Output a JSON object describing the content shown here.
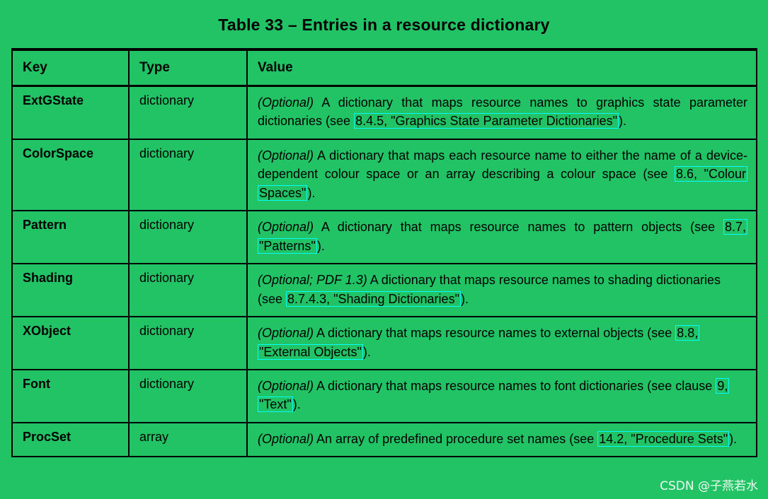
{
  "title": "Table 33 –  Entries in a resource dictionary",
  "columns": [
    "Key",
    "Type",
    "Value"
  ],
  "rows": [
    {
      "key": "ExtGState",
      "type": "dictionary",
      "optional": "(Optional)",
      "value_pre": " A dictionary that maps resource names to graphics state parameter dictionaries (see ",
      "link": "8.4.5, \"Graphics State Parameter Dictionaries\"",
      "value_post": ")."
    },
    {
      "key": "ColorSpace",
      "type": "dictionary",
      "optional": "(Optional)",
      "value_pre": " A dictionary that maps each resource name to either the name of a device-dependent colour space or an array describing a colour space (see ",
      "link": "8.6, \"Colour Spaces\"",
      "value_post": ")."
    },
    {
      "key": "Pattern",
      "type": "dictionary",
      "optional": "(Optional)",
      "value_pre": " A dictionary that maps resource names to pattern objects (see ",
      "link": "8.7, \"Patterns\"",
      "value_post": ")."
    },
    {
      "key": "Shading",
      "type": "dictionary",
      "optional": "(Optional; PDF 1.3)",
      "value_pre": " A dictionary that maps resource names to shading dictionaries (see ",
      "link": "8.7.4.3, \"Shading Dictionaries\"",
      "value_post": ")."
    },
    {
      "key": "XObject",
      "type": "dictionary",
      "optional": "(Optional)",
      "value_pre": " A dictionary that maps resource names to external objects (see ",
      "link": "8.8, \"External Objects\"",
      "value_post": ")."
    },
    {
      "key": "Font",
      "type": "dictionary",
      "optional": "(Optional)",
      "value_pre": " A dictionary that maps resource names to font dictionaries (see clause ",
      "link": "9, \"Text\"",
      "value_post": ")."
    },
    {
      "key": "ProcSet",
      "type": "array",
      "optional": "(Optional)",
      "value_pre": " An array of predefined procedure set names (see ",
      "link": "14.2, \"Procedure Sets\"",
      "value_post": ")."
    }
  ],
  "watermark": "CSDN @子燕若水",
  "colors": {
    "background": "#22c365",
    "text": "#000000",
    "link_box": "#00ffff",
    "watermark": "#ffffff"
  }
}
